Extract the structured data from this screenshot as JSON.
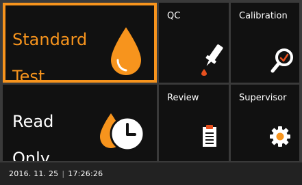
{
  "tiles": {
    "standard_test": {
      "line1": "Standard",
      "line2": "Test",
      "icon": "drop-icon"
    },
    "qc": {
      "label": "QC",
      "icon": "dropper-icon"
    },
    "calibration": {
      "label": "Calibration",
      "icon": "magnifier-icon"
    },
    "read_only": {
      "line1": "Read",
      "line2": "Only",
      "icon": "drop-clock-icon"
    },
    "review": {
      "label": "Review",
      "icon": "clipboard-icon"
    },
    "supervisor": {
      "label": "Supervisor",
      "icon": "gear-icon"
    }
  },
  "status": {
    "date": "2016. 11. 25",
    "separator": "|",
    "time": "17:26:26"
  },
  "colors": {
    "accent": "#f7941d",
    "tile": "#111111",
    "background": "#3a3a3a"
  }
}
